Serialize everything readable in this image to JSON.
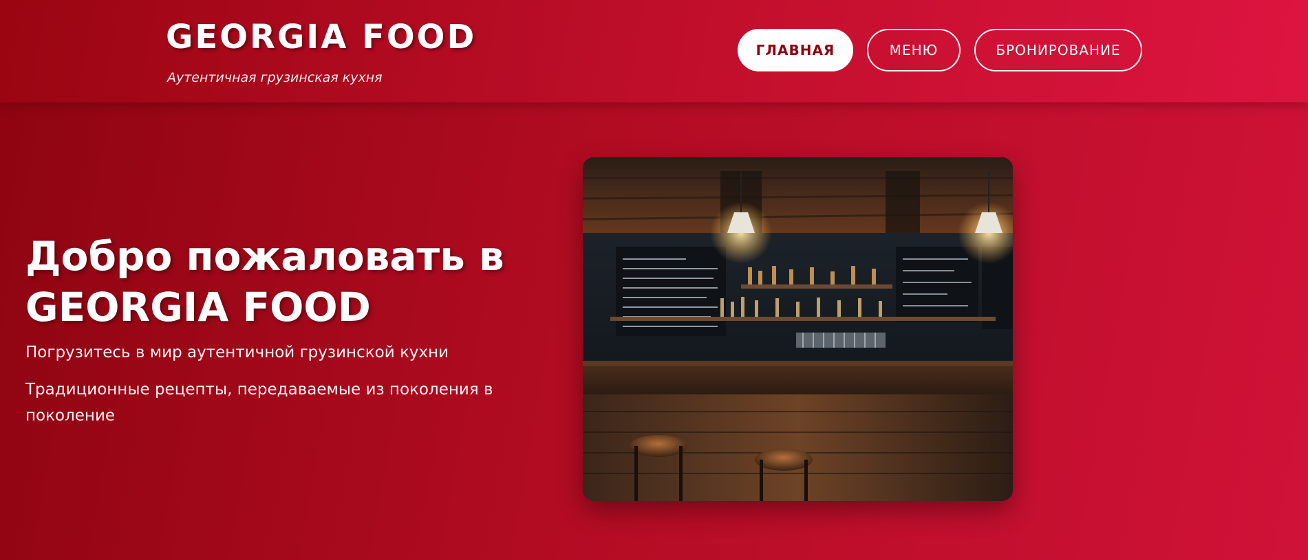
{
  "header": {
    "brand_title": "GEORGIA FOOD",
    "brand_subtitle": "Аутентичная грузинская кухня",
    "nav": [
      {
        "label": "ГЛАВНАЯ",
        "active": true
      },
      {
        "label": "МЕНЮ",
        "active": false
      },
      {
        "label": "БРОНИРОВАНИЕ",
        "active": false
      }
    ]
  },
  "hero": {
    "title": "Добро пожаловать в GEORGIA FOOD",
    "line1": "Погрузитесь в мир аутентичной грузинской кухни",
    "line2": "Традиционные рецепты, передаваемые из поколения в поколение"
  },
  "colors": {
    "accent": "#b20c22",
    "accent_dark": "#8e0410",
    "accent_light": "#d01238"
  }
}
